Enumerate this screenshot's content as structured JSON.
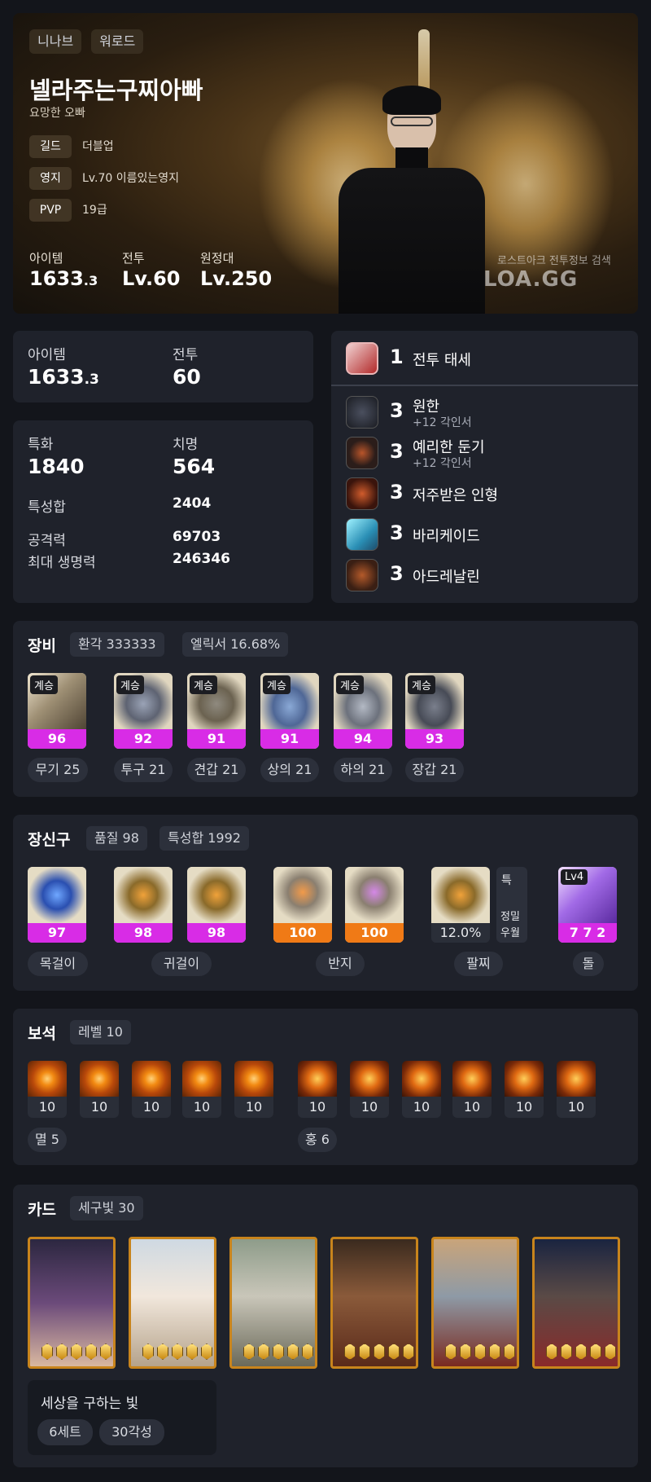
{
  "profile": {
    "server": "니나브",
    "class": "워로드",
    "name": "넬라주는구찌아빠",
    "title": "요망한 오빠",
    "guild_label": "길드",
    "guild": "더블업",
    "estate_label": "영지",
    "estate": "Lv.70 이름있는영지",
    "pvp_label": "PVP",
    "pvp": "19급",
    "item_label": "아이템",
    "item_main": "1633",
    "item_dec": ".3",
    "combat_label": "전투",
    "combat": "Lv.60",
    "expedition_label": "원정대",
    "expedition": "Lv.250",
    "watermark_small": "로스트아크 전투정보 검색",
    "watermark": "LOA.GG"
  },
  "summary": {
    "item_label": "아이템",
    "item_main": "1633",
    "item_dec": ".3",
    "combat_label": "전투",
    "combat": "60"
  },
  "stats": {
    "spec_label": "특화",
    "spec": "1840",
    "crit_label": "치명",
    "crit": "564",
    "total_label": "특성합",
    "total": "2404",
    "atk_label": "공격력",
    "atk": "69703",
    "hp_label": "최대 생명력",
    "hp": "246346"
  },
  "engravings": {
    "class": {
      "level": "1",
      "name": "전투 태세"
    },
    "list": [
      {
        "level": "3",
        "name": "원한",
        "sub": "+12 각인서",
        "icon": "grudge-icon"
      },
      {
        "level": "3",
        "name": "예리한 둔기",
        "sub": "+12 각인서",
        "icon": "keen-blunt-icon"
      },
      {
        "level": "3",
        "name": "저주받은 인형",
        "sub": "",
        "icon": "cursed-doll-icon"
      },
      {
        "level": "3",
        "name": "바리케이드",
        "sub": "",
        "icon": "barricade-icon"
      },
      {
        "level": "3",
        "name": "아드레날린",
        "sub": "",
        "icon": "adrenaline-icon"
      }
    ]
  },
  "equipment": {
    "title": "장비",
    "transcend": "환각 333333",
    "elixir": "엘릭서 16.68%",
    "tag": "계승",
    "items": [
      {
        "quality": "96",
        "label": "무기 25"
      },
      {
        "quality": "92",
        "label": "투구 21"
      },
      {
        "quality": "91",
        "label": "견갑 21"
      },
      {
        "quality": "91",
        "label": "상의 21"
      },
      {
        "quality": "94",
        "label": "하의 21"
      },
      {
        "quality": "93",
        "label": "장갑 21"
      }
    ]
  },
  "accessories": {
    "title": "장신구",
    "quality": "품질 98",
    "stat_total": "특성합 1992",
    "necklace": "97",
    "earring1": "98",
    "earring2": "98",
    "ring1": "100",
    "ring2": "100",
    "bracelet": "12.0%",
    "bracelet_tag1": "특",
    "bracelet_tag2": "정밀",
    "bracelet_tag3": "우월",
    "stone_level": "Lv4",
    "stone_value": "7 7 2",
    "labels": {
      "necklace": "목걸이",
      "earring": "귀걸이",
      "ring": "반지",
      "bracelet": "팔찌",
      "stone": "돌"
    },
    "colors": {
      "magenta": "#d82ce6",
      "orange": "#f07a16"
    }
  },
  "gems": {
    "title": "보석",
    "level_pill": "레벨 10",
    "left": [
      "10",
      "10",
      "10",
      "10",
      "10"
    ],
    "right": [
      "10",
      "10",
      "10",
      "10",
      "10",
      "10"
    ],
    "left_label": "멸 5",
    "right_label": "홍 6"
  },
  "cards": {
    "title": "카드",
    "set_pill": "세구빛 30",
    "set_name": "세상을 구하는 빛",
    "sets": "6세트",
    "awaken": "30각성"
  }
}
